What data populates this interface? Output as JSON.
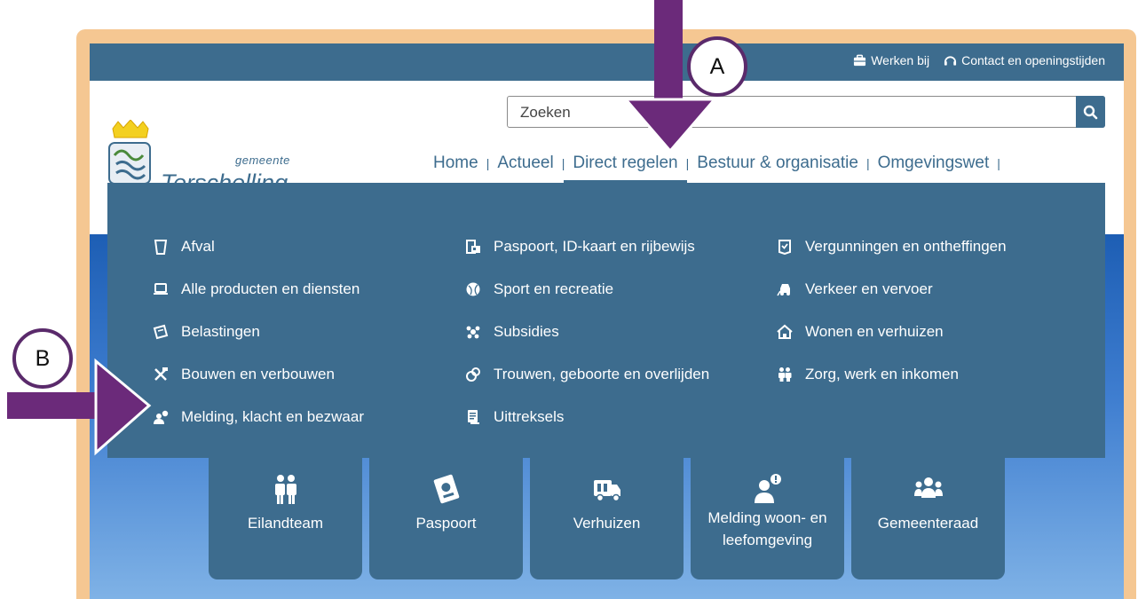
{
  "topbar": {
    "werken_label": "Werken bij",
    "contact_label": "Contact en openingstijden"
  },
  "search": {
    "placeholder": "Zoeken"
  },
  "logo": {
    "small": "gemeente",
    "big": "Terschelling"
  },
  "nav": {
    "items": [
      "Home",
      "Actueel",
      "Direct regelen",
      "Bestuur & organisatie",
      "Omgevingswet"
    ],
    "active": "Direct regelen"
  },
  "menu": {
    "col1": [
      {
        "label": "Afval",
        "icon": "bin-icon"
      },
      {
        "label": "Alle producten en diensten",
        "icon": "laptop-icon"
      },
      {
        "label": "Belastingen",
        "icon": "ticket-icon"
      },
      {
        "label": "Bouwen en verbouwen",
        "icon": "tools-icon"
      },
      {
        "label": "Melding, klacht en bezwaar",
        "icon": "user-alert-icon"
      }
    ],
    "col2": [
      {
        "label": "Paspoort, ID-kaart en rijbewijs",
        "icon": "id-card-icon"
      },
      {
        "label": "Sport en recreatie",
        "icon": "ball-icon"
      },
      {
        "label": "Subsidies",
        "icon": "group-icon"
      },
      {
        "label": "Trouwen, geboorte en overlijden",
        "icon": "rings-icon"
      },
      {
        "label": "Uittreksels",
        "icon": "document-icon"
      }
    ],
    "col3": [
      {
        "label": "Vergunningen en ontheffingen",
        "icon": "permit-icon"
      },
      {
        "label": "Verkeer en vervoer",
        "icon": "car-icon"
      },
      {
        "label": "Wonen en verhuizen",
        "icon": "house-icon"
      },
      {
        "label": "Zorg, werk en inkomen",
        "icon": "people-icon"
      }
    ]
  },
  "tiles": [
    {
      "label": "Eilandteam",
      "icon": "team-icon"
    },
    {
      "label": "Paspoort",
      "icon": "passport-icon"
    },
    {
      "label": "Verhuizen",
      "icon": "truck-icon"
    },
    {
      "label": "Melding woon- en leefomgeving",
      "icon": "report-icon"
    },
    {
      "label": "Gemeenteraad",
      "icon": "council-icon"
    }
  ],
  "annotations": {
    "a": "A",
    "b": "B"
  },
  "colors": {
    "primary": "#3d6c8e",
    "frame": "#f5c792",
    "arrow": "#6b2a7a",
    "circle_border": "#5a2a6b"
  }
}
